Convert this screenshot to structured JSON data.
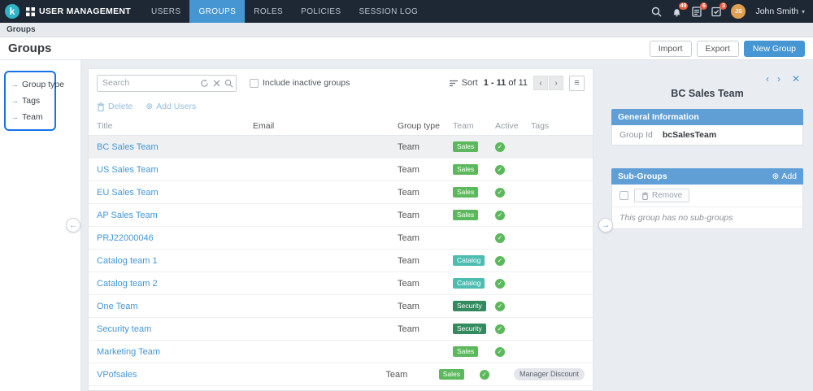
{
  "topbar": {
    "logo_letter": "k",
    "app_title": "USER MANAGEMENT",
    "nav": [
      {
        "label": "USERS",
        "active": false
      },
      {
        "label": "GROUPS",
        "active": true
      },
      {
        "label": "ROLES",
        "active": false
      },
      {
        "label": "POLICIES",
        "active": false
      },
      {
        "label": "SESSION LOG",
        "active": false
      }
    ],
    "badges": {
      "notifications": "49",
      "tasks": "6",
      "approvals": "3"
    },
    "user": {
      "initials": "JS",
      "name": "John Smith"
    }
  },
  "breadcrumb": {
    "path": "Groups"
  },
  "page": {
    "title": "Groups",
    "import_label": "Import",
    "export_label": "Export",
    "new_group_label": "New Group"
  },
  "sidebar": {
    "items": [
      {
        "label": "Group type"
      },
      {
        "label": "Tags"
      },
      {
        "label": "Team"
      }
    ]
  },
  "list": {
    "search_placeholder": "Search",
    "include_inactive_label": "Include inactive groups",
    "sort_label": "Sort",
    "pagination": {
      "range": "1 - 11",
      "of": "of 11"
    },
    "delete_label": "Delete",
    "add_users_label": "Add Users",
    "columns": [
      "Title",
      "Email",
      "Group type",
      "Team",
      "Active",
      "Tags"
    ],
    "rows": [
      {
        "title": "BC Sales Team",
        "email": "",
        "group_type": "Team",
        "team": "Sales",
        "active": true,
        "tags": "",
        "selected": true
      },
      {
        "title": "US Sales Team",
        "email": "",
        "group_type": "Team",
        "team": "Sales",
        "active": true,
        "tags": "",
        "selected": false
      },
      {
        "title": "EU Sales Team",
        "email": "",
        "group_type": "Team",
        "team": "Sales",
        "active": true,
        "tags": "",
        "selected": false
      },
      {
        "title": "AP Sales Team",
        "email": "",
        "group_type": "Team",
        "team": "Sales",
        "active": true,
        "tags": "",
        "selected": false
      },
      {
        "title": "PRJ22000046",
        "email": "",
        "group_type": "Team",
        "team": "",
        "active": true,
        "tags": "",
        "selected": false
      },
      {
        "title": "Catalog team 1",
        "email": "",
        "group_type": "Team",
        "team": "Catalog",
        "active": true,
        "tags": "",
        "selected": false
      },
      {
        "title": "Catalog team 2",
        "email": "",
        "group_type": "Team",
        "team": "Catalog",
        "active": true,
        "tags": "",
        "selected": false
      },
      {
        "title": "One Team",
        "email": "",
        "group_type": "Team",
        "team": "Security",
        "active": true,
        "tags": "",
        "selected": false
      },
      {
        "title": "Security team",
        "email": "",
        "group_type": "Team",
        "team": "Security",
        "active": true,
        "tags": "",
        "selected": false
      },
      {
        "title": "Marketing Team",
        "email": "",
        "group_type": "",
        "team": "Sales",
        "active": true,
        "tags": "",
        "selected": false
      },
      {
        "title": "VPofsales",
        "email": "",
        "group_type": "Team",
        "team": "Sales",
        "active": true,
        "tags": "Manager Discount",
        "selected": false
      }
    ]
  },
  "detail": {
    "title": "BC Sales Team",
    "general": {
      "header": "General Information",
      "group_id_label": "Group Id",
      "group_id_value": "bcSalesTeam"
    },
    "subgroups": {
      "header": "Sub-Groups",
      "add_label": "Add",
      "remove_label": "Remove",
      "empty_text": "This group has no sub-groups"
    }
  },
  "colors": {
    "accent": "#4596d3",
    "topbar_bg": "#1e2834",
    "section_header_bg": "#5f9fd6",
    "active_check": "#5cb85c",
    "team_colors": {
      "Sales": "#5cb85c",
      "Catalog": "#4dbdb2",
      "Security": "#338a5e"
    }
  }
}
